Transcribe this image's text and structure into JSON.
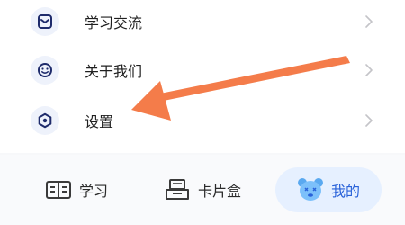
{
  "menu": {
    "items": [
      {
        "label": "学习交流",
        "icon": "message-icon"
      },
      {
        "label": "关于我们",
        "icon": "smile-icon"
      },
      {
        "label": "设置",
        "icon": "settings-hex-icon"
      }
    ]
  },
  "tabs": [
    {
      "label": "学习",
      "icon": "study-icon"
    },
    {
      "label": "卡片盒",
      "icon": "card-box-icon"
    },
    {
      "label": "我的",
      "icon": "bear-icon",
      "active": true
    }
  ],
  "colors": {
    "accent": "#1e2b6b",
    "active_tab_text": "#2962d9",
    "active_tab_bg": "#e6f0ff",
    "arrow": "#f47c4a"
  }
}
